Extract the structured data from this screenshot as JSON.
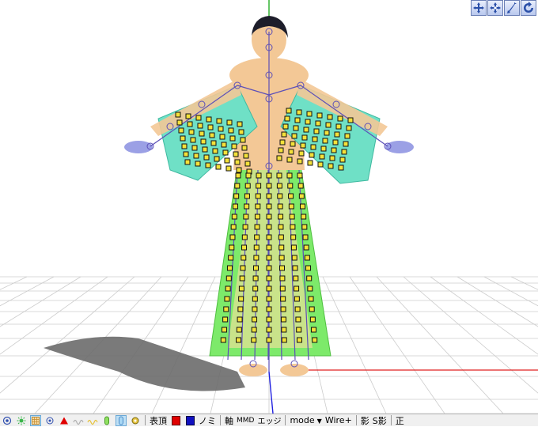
{
  "toolbar": {
    "show_label": "表頂",
    "nomi_label": "ノミ",
    "axis_label": "軸",
    "mmd_label": "MMD",
    "edge_label": "エッジ",
    "mode_label": "mode",
    "wire_label": "Wire+",
    "shadow_label": "影",
    "sshadow_label": "S影",
    "front_label": "正"
  },
  "colors": {
    "grid": "#cccccc",
    "axis_x": "#e02020",
    "axis_y": "#00a000",
    "axis_z": "#2020e0",
    "skin": "#f3c896",
    "sleeve": "#6fe0c6",
    "robe": "#7dea6a",
    "robe_inner": "#c9e38a",
    "bone": "#5c4fb8",
    "rigid": "#f4e13a",
    "shadow": "#6b6b6b",
    "swatch_red": "#e00000",
    "swatch_blue": "#1010c0"
  }
}
